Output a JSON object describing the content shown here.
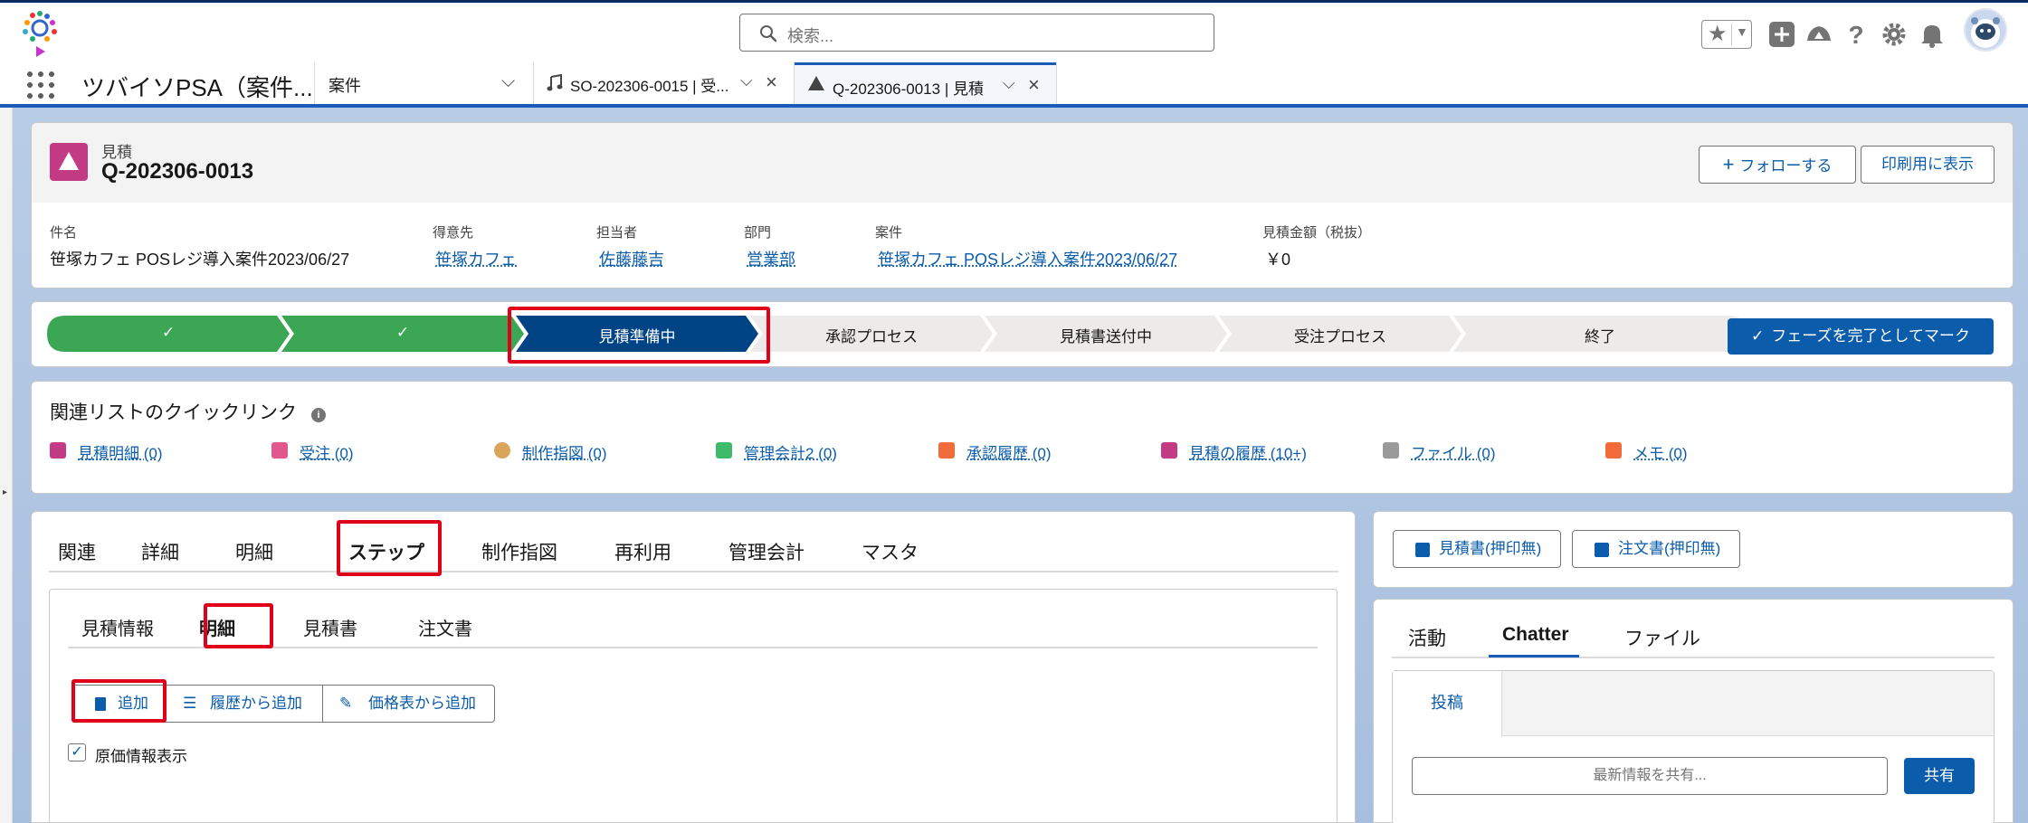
{
  "header": {
    "search_placeholder": "検索..."
  },
  "nav": {
    "app_name": "ツバイソPSA（案件...",
    "object_tab": "案件",
    "workspace_tabs": [
      {
        "label": "SO-202306-0015 | 受...",
        "icon": "music-note-icon"
      },
      {
        "label": "Q-202306-0013 | 見積",
        "icon": "triangle-icon"
      }
    ]
  },
  "record": {
    "type_label": "見積",
    "name": "Q-202306-0013",
    "follow_label": "フォローする",
    "print_label": "印刷用に表示",
    "fields": [
      {
        "label": "件名",
        "value": "笹塚カフェ POSレジ導入案件2023/06/27",
        "link": false
      },
      {
        "label": "得意先",
        "value": "笹塚カフェ",
        "link": true
      },
      {
        "label": "担当者",
        "value": "佐藤藤吉",
        "link": true
      },
      {
        "label": "部門",
        "value": "営業部",
        "link": true
      },
      {
        "label": "案件",
        "value": "笹塚カフェ POSレジ導入案件2023/06/27",
        "link": true
      },
      {
        "label": "見積金額（税抜）",
        "value": "￥0",
        "link": false
      }
    ]
  },
  "path": {
    "stages": [
      {
        "label": "✓",
        "status": "complete"
      },
      {
        "label": "✓",
        "status": "complete"
      },
      {
        "label": "見積準備中",
        "status": "current"
      },
      {
        "label": "承認プロセス",
        "status": "incomplete"
      },
      {
        "label": "見積書送付中",
        "status": "incomplete"
      },
      {
        "label": "受注プロセス",
        "status": "incomplete"
      },
      {
        "label": "終了",
        "status": "incomplete"
      }
    ],
    "mark_button": "フェーズを完了としてマーク"
  },
  "quick_links": {
    "title": "関連リストのクイックリンク",
    "items": [
      {
        "label": "見積明細 (0)",
        "color": "#c23b84"
      },
      {
        "label": "受注 (0)",
        "color": "#e0588e"
      },
      {
        "label": "制作指図 (0)",
        "color": "#d9a55a"
      },
      {
        "label": "管理会計2 (0)",
        "color": "#3fb96b"
      },
      {
        "label": "承認履歴 (0)",
        "color": "#f26c3a"
      },
      {
        "label": "見積の履歴 (10+)",
        "color": "#c23b84"
      },
      {
        "label": "ファイル (0)",
        "color": "#9a9a9a"
      },
      {
        "label": "メモ (0)",
        "color": "#f26c3a"
      }
    ]
  },
  "main_tabs": [
    "関連",
    "詳細",
    "明細",
    "ステップ",
    "制作指図",
    "再利用",
    "管理会計",
    "マスタ"
  ],
  "selected_main_tab": "ステップ",
  "sub_tabs": [
    "見積情報",
    "明細",
    "見積書",
    "注文書"
  ],
  "selected_sub_tab": "明細",
  "actions": {
    "add": "追加",
    "add_from_history": "履歴から追加",
    "add_from_pricebook": "価格表から追加"
  },
  "cost_checkbox": {
    "label": "原価情報表示",
    "checked": true
  },
  "right_panel": {
    "quote_print_btn": "見積書(押印無)",
    "order_print_btn": "注文書(押印無)",
    "feed_tabs": [
      "活動",
      "Chatter",
      "ファイル"
    ],
    "selected_feed_tab": "Chatter",
    "post_tab": "投稿",
    "share_placeholder": "最新情報を共有...",
    "share_button": "共有"
  },
  "colors": {
    "brand_blue": "#0b5cab",
    "path_complete": "#3ba755",
    "path_current": "#014486",
    "highlight_red": "#e1001a"
  }
}
